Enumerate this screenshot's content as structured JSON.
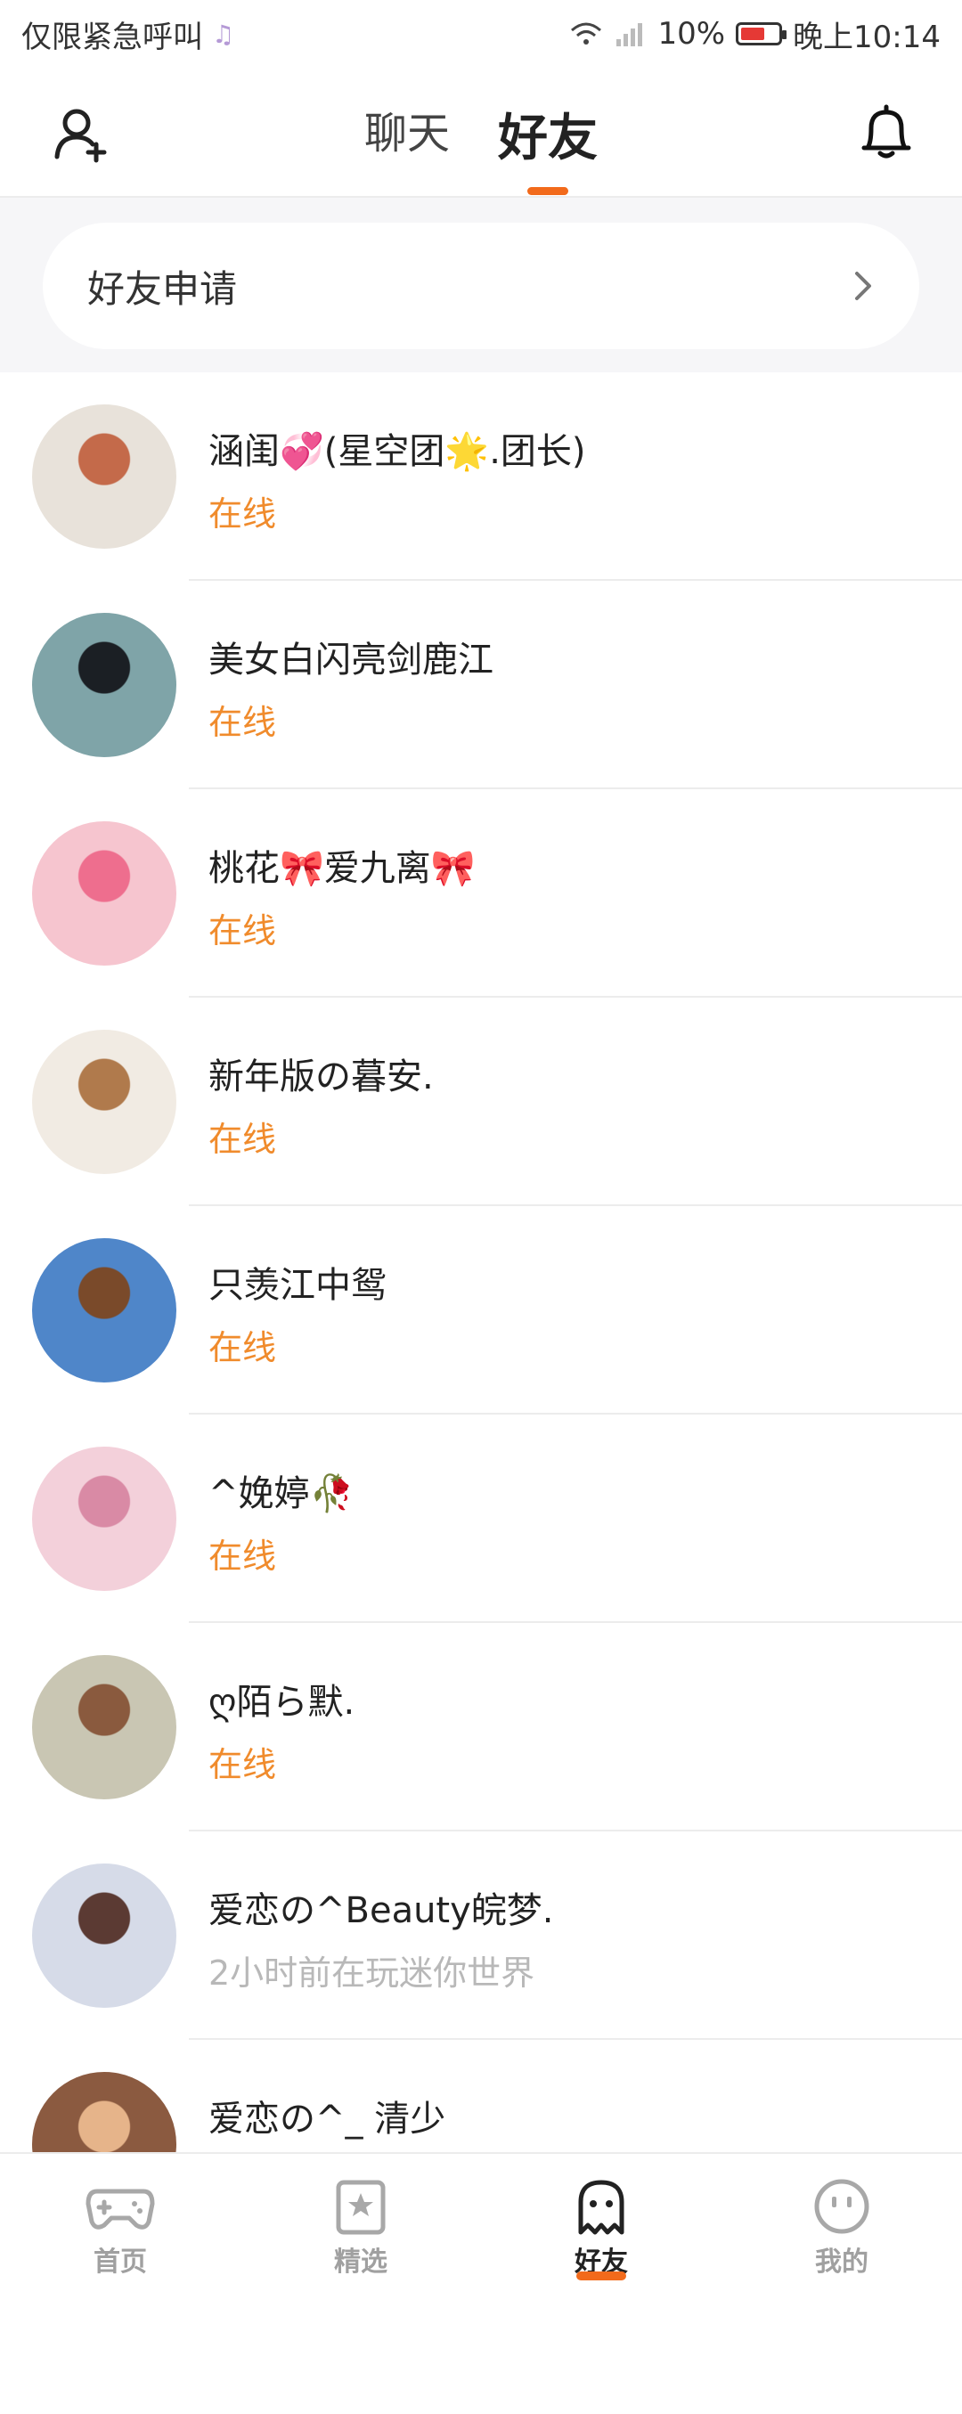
{
  "status_bar": {
    "carrier": "仅限紧急呼叫",
    "battery": "10%",
    "time": "晚上10:14"
  },
  "header": {
    "tabs": [
      {
        "label": "聊天",
        "active": false
      },
      {
        "label": "好友",
        "active": true
      }
    ],
    "icons": [
      "add-friend-icon",
      "bell-icon"
    ],
    "accent_color": "#f26a1b"
  },
  "friend_request": {
    "label": "好友申请"
  },
  "friends": [
    {
      "name": "涵闺💞(星空团🌟.团长)",
      "status": "在线",
      "online": true,
      "avatar_bg": "#e8e2da",
      "avatar_fg": "#c46a4a"
    },
    {
      "name": "美女白闪亮剑鹿江",
      "status": "在线",
      "online": true,
      "avatar_bg": "#7fa4a8",
      "avatar_fg": "#1b1f24"
    },
    {
      "name": "桃花🎀爱九离🎀",
      "status": "在线",
      "online": true,
      "avatar_bg": "#f6c5cf",
      "avatar_fg": "#ee6e8e"
    },
    {
      "name": "新年版の暮安.",
      "status": "在线",
      "online": true,
      "avatar_bg": "#f1ebe3",
      "avatar_fg": "#b07a4c"
    },
    {
      "name": "只羡江中鸳",
      "status": "在线",
      "online": true,
      "avatar_bg": "#4f86c9",
      "avatar_fg": "#7a4a2a"
    },
    {
      "name": "^娩婷🥀",
      "status": "在线",
      "online": true,
      "avatar_bg": "#f3d0da",
      "avatar_fg": "#d98aa5"
    },
    {
      "name": "ღ陌ら默.",
      "status": "在线",
      "online": true,
      "avatar_bg": "#c9c6b3",
      "avatar_fg": "#8a5a3e"
    },
    {
      "name": "爱恋の^Beauty皖梦.",
      "status": "2小时前在玩迷你世界",
      "online": false,
      "avatar_bg": "#d6dbe8",
      "avatar_fg": "#5b3a33"
    },
    {
      "name": "爱恋の^_  清少",
      "status": "",
      "online": false,
      "avatar_bg": "#8b5a40",
      "avatar_fg": "#e6b48a"
    }
  ],
  "bottom_nav": [
    {
      "label": "首页",
      "icon": "gamepad-icon",
      "active": false
    },
    {
      "label": "精选",
      "icon": "star-bookmark-icon",
      "active": false
    },
    {
      "label": "好友",
      "icon": "ghost-icon",
      "active": true
    },
    {
      "label": "我的",
      "icon": "face-icon",
      "active": false
    }
  ]
}
